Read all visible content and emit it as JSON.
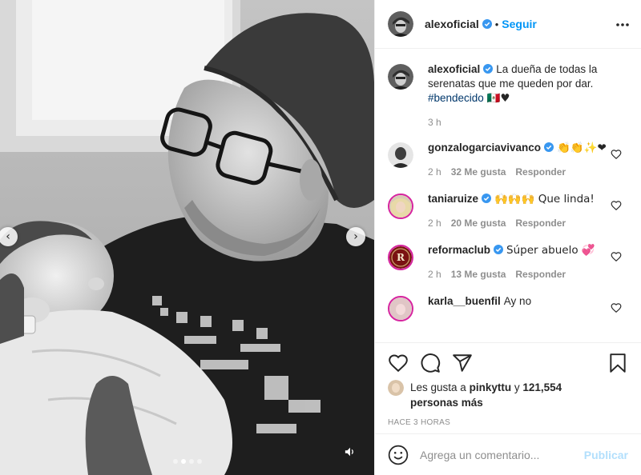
{
  "post": {
    "author": "alexoficial",
    "follow_label": "Seguir",
    "separator": "•"
  },
  "caption": {
    "username": "alexoficial",
    "text": "La dueña de todas la serenatas que me queden por dar.",
    "hashtag": "#bendecido",
    "emoji": "🇲🇽♥",
    "time": "3 h"
  },
  "comments": [
    {
      "username": "gonzalogarciavivanco",
      "verified": true,
      "text": "👏👏✨❤",
      "time": "2 h",
      "likes": "32 Me gusta",
      "reply": "Responder"
    },
    {
      "username": "taniaruize",
      "verified": true,
      "text": "🙌🙌🙌 Que linda!",
      "time": "2 h",
      "likes": "20 Me gusta",
      "reply": "Responder"
    },
    {
      "username": "reformaclub",
      "verified": true,
      "text": "Súper abuelo 💞",
      "time": "2 h",
      "likes": "13 Me gusta",
      "reply": "Responder",
      "avatar_letter": "R"
    },
    {
      "username": "karla__buenfil",
      "verified": false,
      "text": "Ay no",
      "time": "",
      "likes": "",
      "reply": ""
    }
  ],
  "likes": {
    "prefix": "Les gusta a",
    "user": "pinkyttu",
    "joiner": "y",
    "count": "121,554 personas más"
  },
  "timestamp": "HACE 3 HORAS",
  "comment_box": {
    "placeholder": "Agrega un comentario...",
    "publish_label": "Publicar"
  },
  "carousel": {
    "slides": 4,
    "active": 1
  },
  "colors": {
    "accent": "#0095f6",
    "verified": "#3897f0",
    "publish_disabled": "#b2dffc",
    "muted": "#8e8e8e"
  },
  "icons": [
    "chevron-left-icon",
    "chevron-right-icon",
    "volume-icon",
    "more-icon",
    "heart-icon",
    "comment-icon",
    "share-icon",
    "bookmark-icon",
    "emoji-icon",
    "verified-icon"
  ]
}
